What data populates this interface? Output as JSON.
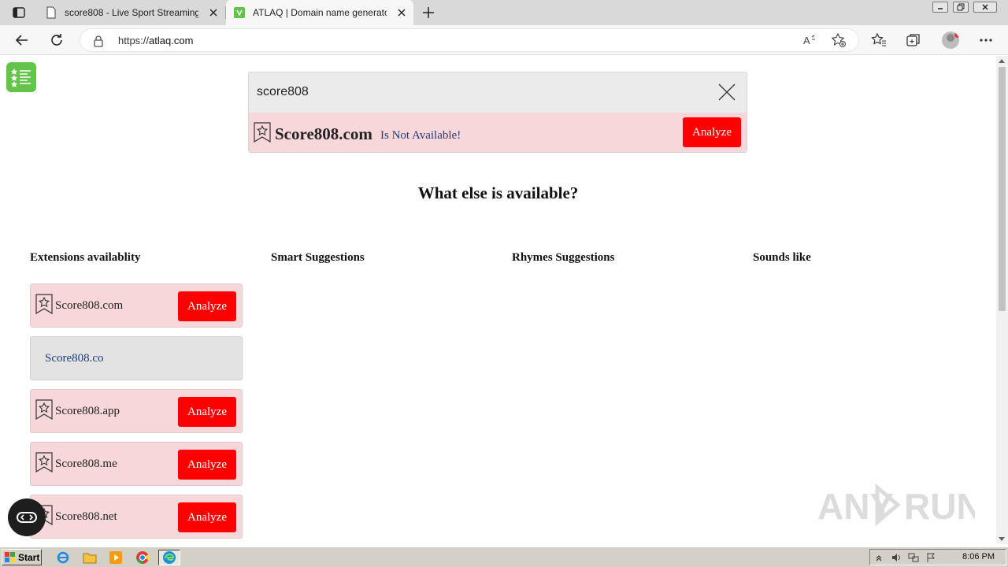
{
  "browser": {
    "tabs": [
      {
        "title": "score808 - Live Sport Streaming, V",
        "active": false
      },
      {
        "title": "ATLAQ | Domain name generator",
        "active": true
      }
    ],
    "url_prefix": "https://",
    "url_host": "atlaq.com"
  },
  "search": {
    "query": "score808"
  },
  "main_result": {
    "domain": "Score808.com",
    "status": "Is Not Available!",
    "analyze_label": "Analyze"
  },
  "section_heading": "What else is available?",
  "columns": [
    {
      "title": "Extensions availablity"
    },
    {
      "title": "Smart Suggestions"
    },
    {
      "title": "Rhymes Suggestions"
    },
    {
      "title": "Sounds like"
    }
  ],
  "extensions": [
    {
      "name": "Score808.com",
      "available": false,
      "analyze_label": "Analyze"
    },
    {
      "name": "Score808.co",
      "available": true
    },
    {
      "name": "Score808.app",
      "available": false,
      "analyze_label": "Analyze"
    },
    {
      "name": "Score808.me",
      "available": false,
      "analyze_label": "Analyze"
    },
    {
      "name": "Score808.net",
      "available": false,
      "analyze_label": "Analyze"
    }
  ],
  "watermark": "ANY RUN",
  "taskbar": {
    "start_label": "Start",
    "clock": "8:06 PM"
  },
  "colors": {
    "analyze_red": "#ff0000",
    "unavailable_bg": "#f8d7da",
    "available_bg": "#e3e3e3",
    "list_button_green": "#63c34a"
  }
}
